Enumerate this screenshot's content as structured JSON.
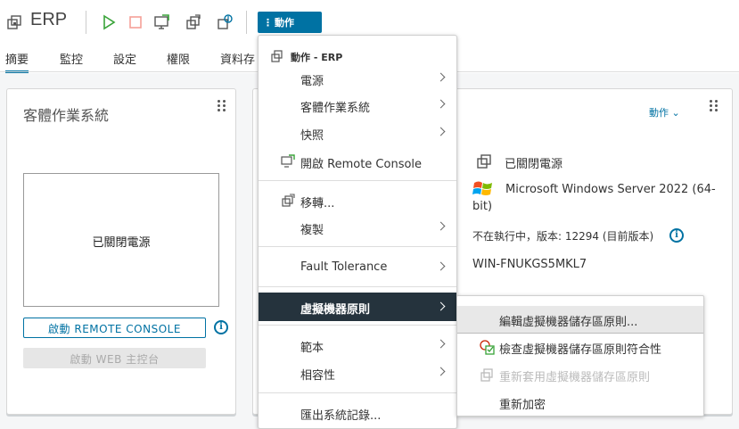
{
  "header": {
    "title": "ERP",
    "actions_label": "動作"
  },
  "tabs": [
    "摘要",
    "監控",
    "設定",
    "權限",
    "資料存"
  ],
  "guest_card": {
    "title": "客體作業系統",
    "console_status": "已關閉電源",
    "launch_remote_label": "啟動 REMOTE CONSOLE",
    "launch_web_label": "啟動 WEB 主控台"
  },
  "summary_card": {
    "actions_link": "動作",
    "power_state": "已關閉電源",
    "os_line1": "Microsoft Windows Server 2022 (64-",
    "os_line2": "bit)",
    "tools_status": "不在執行中，版本: 12294 (目前版本)",
    "hostname": "WIN-FNUKGS5MKL7"
  },
  "menu": {
    "header": "動作 - ERP",
    "items": [
      {
        "label": "電源",
        "arrow": true
      },
      {
        "label": "客體作業系統",
        "arrow": true
      },
      {
        "label": "快照",
        "arrow": true
      },
      {
        "label": "開啟 Remote Console",
        "arrow": false
      },
      {
        "label": "移轉...",
        "arrow": false
      },
      {
        "label": "複製",
        "arrow": true
      },
      {
        "label": "Fault Tolerance",
        "arrow": true
      },
      {
        "label": "虛擬機器原則",
        "arrow": true
      },
      {
        "label": "範本",
        "arrow": true
      },
      {
        "label": "相容性",
        "arrow": true
      },
      {
        "label": "匯出系統記錄...",
        "arrow": false
      }
    ]
  },
  "submenu": {
    "items": [
      {
        "label": "編輯虛擬機器儲存區原則..."
      },
      {
        "label": "檢查虛擬機器儲存區原則符合性"
      },
      {
        "label": "重新套用虛擬機器儲存區原則"
      },
      {
        "label": "重新加密"
      }
    ]
  },
  "colors": {
    "accent": "#0072a3",
    "menu_selected": "#25333d",
    "play_green": "#39a339",
    "stop_orange": "#f5a097"
  }
}
